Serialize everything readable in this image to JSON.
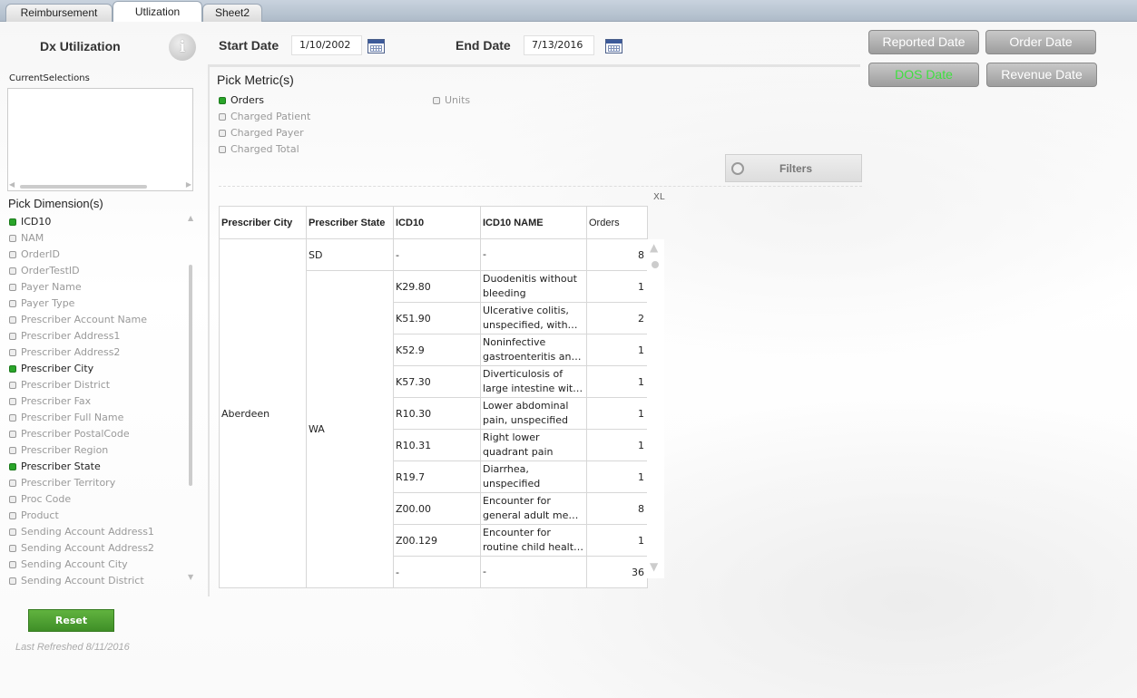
{
  "tabs": [
    {
      "label": "Reimbursement"
    },
    {
      "label": "Utlization"
    },
    {
      "label": "Sheet2"
    }
  ],
  "left": {
    "title": "Dx Utilization",
    "info_icon": "info-icon",
    "current_selections_label": "CurrentSelections",
    "pick_dimensions_title": "Pick Dimension(s)",
    "dimensions": [
      {
        "label": "ICD10",
        "checked": true
      },
      {
        "label": "NAM",
        "checked": false
      },
      {
        "label": "OrderID",
        "checked": false
      },
      {
        "label": "OrderTestID",
        "checked": false
      },
      {
        "label": "Payer Name",
        "checked": false
      },
      {
        "label": "Payer Type",
        "checked": false
      },
      {
        "label": "Prescriber Account Name",
        "checked": false
      },
      {
        "label": "Prescriber Address1",
        "checked": false
      },
      {
        "label": "Prescriber Address2",
        "checked": false
      },
      {
        "label": "Prescriber City",
        "checked": true
      },
      {
        "label": "Prescriber District",
        "checked": false
      },
      {
        "label": "Prescriber Fax",
        "checked": false
      },
      {
        "label": "Prescriber Full Name",
        "checked": false
      },
      {
        "label": "Prescriber PostalCode",
        "checked": false
      },
      {
        "label": "Prescriber Region",
        "checked": false
      },
      {
        "label": "Prescriber State",
        "checked": true
      },
      {
        "label": "Prescriber Territory",
        "checked": false
      },
      {
        "label": "Proc Code",
        "checked": false
      },
      {
        "label": "Product",
        "checked": false
      },
      {
        "label": "Sending Account Address1",
        "checked": false
      },
      {
        "label": "Sending Account Address2",
        "checked": false
      },
      {
        "label": "Sending Account City",
        "checked": false
      },
      {
        "label": "Sending Account District",
        "checked": false
      }
    ],
    "reset_label": "Reset",
    "last_refreshed": "Last Refreshed 8/11/2016"
  },
  "dates": {
    "start_label": "Start Date",
    "start_value": "1/10/2002",
    "end_label": "End Date",
    "end_value": "7/13/2016"
  },
  "date_buttons": {
    "reported": "Reported Date",
    "order": "Order Date",
    "dos": "DOS Date",
    "revenue": "Revenue Date",
    "dos_text_color": "#3fe03f"
  },
  "metrics": {
    "title": "Pick Metric(s)",
    "items": [
      {
        "label": "Orders",
        "checked": true
      },
      {
        "label": "Charged Patient",
        "checked": false
      },
      {
        "label": "Charged Payer",
        "checked": false
      },
      {
        "label": "Charged Total",
        "checked": false
      },
      {
        "label": "Units",
        "checked": false
      }
    ],
    "filters_label": "Filters",
    "xl_label": "XL"
  },
  "table": {
    "headers": [
      "Prescriber City",
      "Prescriber State",
      "ICD10",
      "ICD10 NAME",
      "Orders"
    ],
    "city": "Aberdeen",
    "groups": [
      {
        "state": "SD",
        "rows": [
          {
            "icd10": "-",
            "name_lines": [
              "-"
            ],
            "orders": "8"
          }
        ]
      },
      {
        "state": "WA",
        "rows": [
          {
            "icd10": "K29.80",
            "name_lines": [
              "Duodenitis without",
              "bleeding"
            ],
            "orders": "1"
          },
          {
            "icd10": "K51.90",
            "name_lines": [
              "Ulcerative colitis,",
              "unspecified, with…"
            ],
            "orders": "2"
          },
          {
            "icd10": "K52.9",
            "name_lines": [
              "Noninfective",
              "gastroenteritis an…"
            ],
            "orders": "1"
          },
          {
            "icd10": "K57.30",
            "name_lines": [
              "Diverticulosis of",
              "large intestine wit…"
            ],
            "orders": "1"
          },
          {
            "icd10": "R10.30",
            "name_lines": [
              "Lower abdominal",
              "pain, unspecified"
            ],
            "orders": "1"
          },
          {
            "icd10": "R10.31",
            "name_lines": [
              "Right lower",
              "quadrant pain"
            ],
            "orders": "1"
          },
          {
            "icd10": "R19.7",
            "name_lines": [
              "Diarrhea,",
              "unspecified"
            ],
            "orders": "1"
          },
          {
            "icd10": "Z00.00",
            "name_lines": [
              "Encounter for",
              "general adult med…"
            ],
            "orders": "8"
          },
          {
            "icd10": "Z00.129",
            "name_lines": [
              "Encounter for",
              "routine child healt…"
            ],
            "orders": "1"
          },
          {
            "icd10": "-",
            "name_lines": [
              "-"
            ],
            "orders": "36"
          }
        ]
      }
    ]
  }
}
